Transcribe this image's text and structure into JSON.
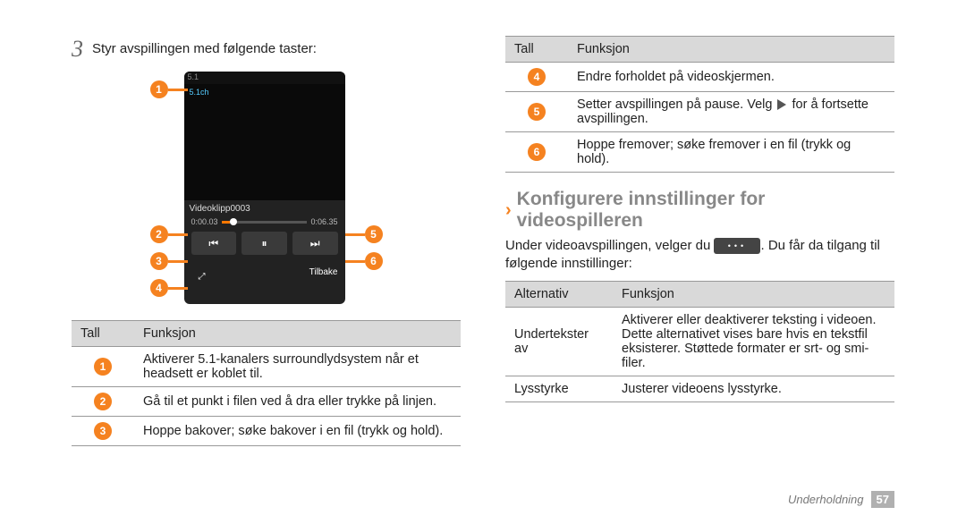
{
  "left": {
    "step_num": "3",
    "intro": "Styr avspillingen med følgende taster:",
    "phone": {
      "status_left": "5.1",
      "status_right": "",
      "audio_icon": "5.1ch",
      "video_title": "Videoklipp0003",
      "time_left": "0:00.03",
      "time_right": "0:06.35",
      "prev_icon": "⏮",
      "play_icon": "⏸",
      "next_icon": "⏭",
      "aspect_icon": "⤢",
      "back_label": "Tilbake"
    },
    "table": {
      "h1": "Tall",
      "h2": "Funksjon",
      "rows": [
        {
          "n": "1",
          "txt": "Aktiverer 5.1-kanalers surroundlydsystem når et headsett er koblet til."
        },
        {
          "n": "2",
          "txt": "Gå til et punkt i filen ved å dra eller trykke på linjen."
        },
        {
          "n": "3",
          "txt": "Hoppe bakover; søke bakover i en fil (trykk og hold)."
        }
      ]
    }
  },
  "right": {
    "table_cont": {
      "h1": "Tall",
      "h2": "Funksjon",
      "rows": [
        {
          "n": "4",
          "txt": "Endre forholdet på videoskjermen."
        },
        {
          "n": "5",
          "txt_a": "Setter avspillingen på pause. Velg ",
          "txt_b": " for å fortsette avspillingen."
        },
        {
          "n": "6",
          "txt": "Hoppe fremover; søke fremover i en fil (trykk og hold)."
        }
      ]
    },
    "section_title": "Konfigurere innstillinger for videospilleren",
    "para_a": "Under videoavspillingen, velger du ",
    "para_b": ". Du får da tilgang til følgende innstillinger:",
    "opt_table": {
      "h1": "Alternativ",
      "h2": "Funksjon",
      "rows": [
        {
          "k": "Undertekster av",
          "v": "Aktiverer eller deaktiverer teksting i videoen. Dette alternativet vises bare hvis en tekstfil eksisterer. Støttede formater er srt- og smi-filer."
        },
        {
          "k": "Lysstyrke",
          "v": "Justerer videoens lysstyrke."
        }
      ]
    }
  },
  "footer": {
    "section": "Underholdning",
    "page": "57"
  }
}
